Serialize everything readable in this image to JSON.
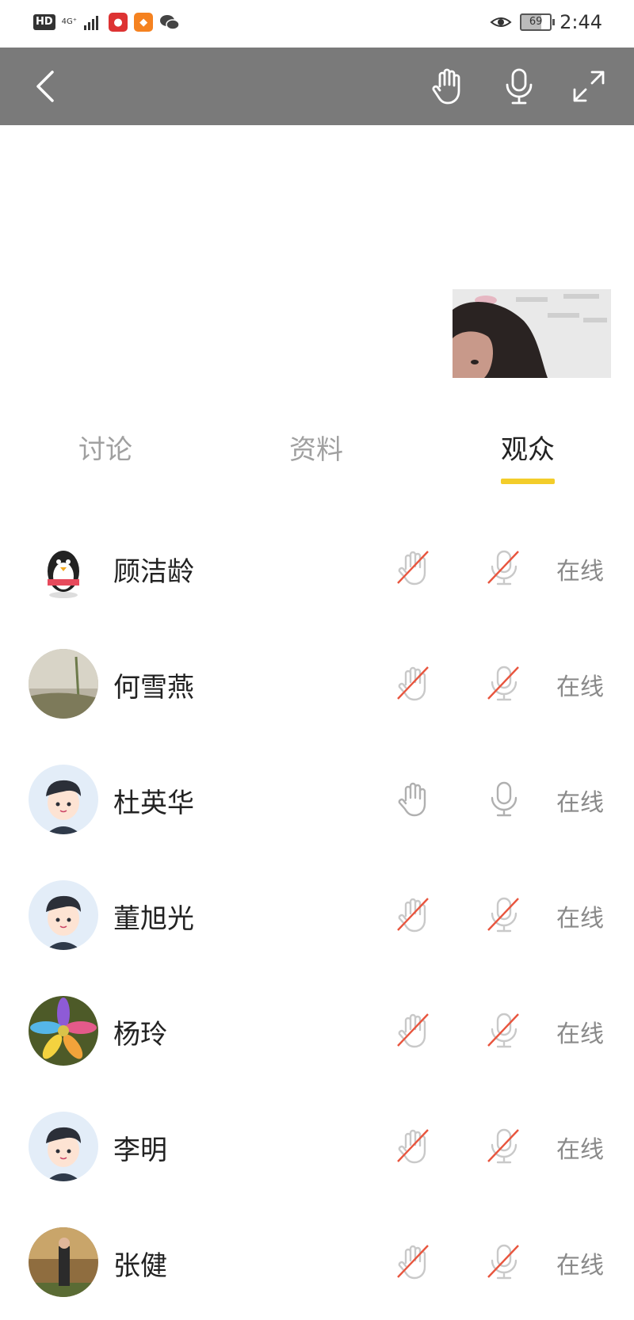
{
  "status_bar": {
    "hd": "HD",
    "network": "4G⁺",
    "battery": "69",
    "time": "2:44"
  },
  "tabs": [
    {
      "label": "讨论",
      "active": false
    },
    {
      "label": "资料",
      "active": false
    },
    {
      "label": "观众",
      "active": true
    }
  ],
  "audience": [
    {
      "name": "顾洁龄",
      "hand_enabled": false,
      "mic_enabled": false,
      "status": "在线",
      "avatar": "penguin-avatar"
    },
    {
      "name": "何雪燕",
      "hand_enabled": false,
      "mic_enabled": false,
      "status": "在线",
      "avatar": "photo-avatar"
    },
    {
      "name": "杜英华",
      "hand_enabled": true,
      "mic_enabled": true,
      "status": "在线",
      "avatar": "cartoon-boy-avatar"
    },
    {
      "name": "董旭光",
      "hand_enabled": false,
      "mic_enabled": false,
      "status": "在线",
      "avatar": "cartoon-boy-avatar"
    },
    {
      "name": "杨玲",
      "hand_enabled": false,
      "mic_enabled": false,
      "status": "在线",
      "avatar": "flower-avatar"
    },
    {
      "name": "李明",
      "hand_enabled": false,
      "mic_enabled": false,
      "status": "在线",
      "avatar": "cartoon-boy-avatar"
    },
    {
      "name": "张健",
      "hand_enabled": false,
      "mic_enabled": false,
      "status": "在线",
      "avatar": "photo-avatar"
    }
  ],
  "colors": {
    "accent": "#f3cd2a",
    "topbar": "#7a7a7a",
    "disabled_slash": "#e8553e"
  }
}
